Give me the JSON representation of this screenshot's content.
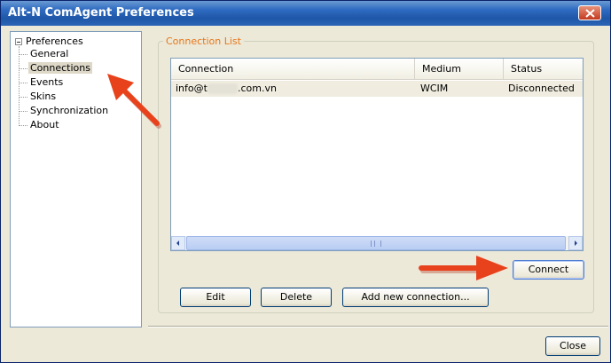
{
  "window": {
    "title": "Alt-N ComAgent Preferences"
  },
  "colors": {
    "title_bar": "#2f6bc1",
    "group_title": "#e8761a",
    "annotation_arrow": "#e8421c"
  },
  "tree": {
    "root": "Preferences",
    "items": [
      {
        "label": "General",
        "selected": false
      },
      {
        "label": "Connections",
        "selected": true
      },
      {
        "label": "Events",
        "selected": false
      },
      {
        "label": "Skins",
        "selected": false
      },
      {
        "label": "Synchronization",
        "selected": false
      },
      {
        "label": "About",
        "selected": false
      }
    ]
  },
  "connection_list": {
    "title": "Connection List",
    "columns": [
      "Connection",
      "Medium",
      "Status"
    ],
    "rows": [
      {
        "connection_prefix": "info@t",
        "connection_suffix": ".com.vn",
        "medium": "WCIM",
        "status": "Disconnected"
      }
    ],
    "scrollbar_glyph": "III"
  },
  "buttons": {
    "connect": "Connect",
    "edit": "Edit",
    "delete": "Delete",
    "add": "Add new connection...",
    "close": "Close"
  },
  "icons": {
    "title_close": "close-icon",
    "scroll_left": "arrow-left-icon",
    "scroll_right": "arrow-right-icon",
    "tree_expander": "minus-box-icon",
    "annotation_1": "red-arrow-icon",
    "annotation_2": "red-arrow-icon"
  }
}
